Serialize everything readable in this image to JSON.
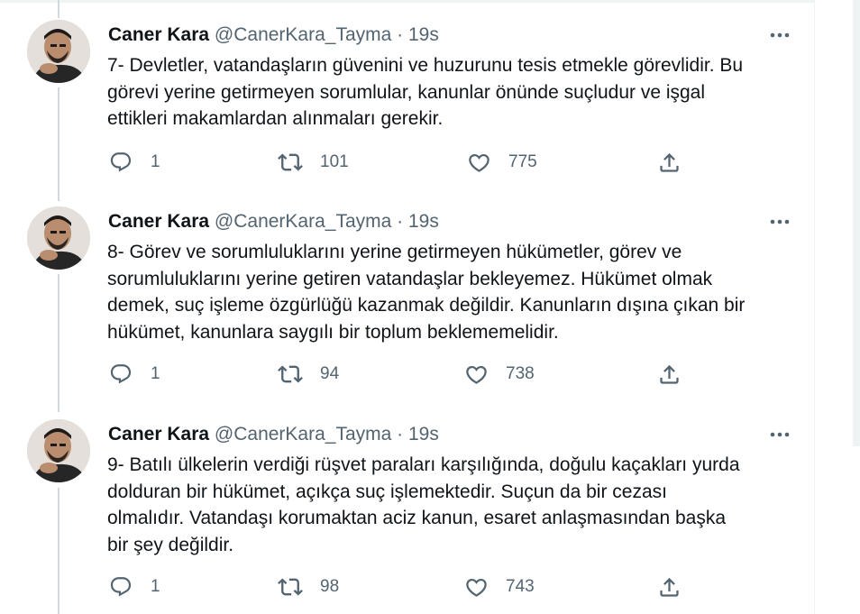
{
  "tweets": [
    {
      "name": "Caner Kara",
      "handle": "@CanerKara_Tayma",
      "time": "19s",
      "text": "7- Devletler, vatandaşların güvenini ve huzurunu tesis etmekle görevlidir. Bu\ngörevi yerine getirmeyen sorumlular, kanunlar önünde suçludur ve işgal\nettikleri makamlardan alınmaları gerekir.",
      "replies": "1",
      "retweets": "101",
      "likes": "775"
    },
    {
      "name": "Caner Kara",
      "handle": "@CanerKara_Tayma",
      "time": "19s",
      "text": "8- Görev ve sorumluluklarını yerine getirmeyen hükümetler, görev ve\nsorumluluklarını yerine getiren vatandaşlar bekleyemez. Hükümet olmak\ndemek, suç işleme özgürlüğü kazanmak değildir. Kanunların dışına çıkan bir\nhükümet, kanunlara saygılı bir toplum beklememelidir.",
      "replies": "1",
      "retweets": "94",
      "likes": "738"
    },
    {
      "name": "Caner Kara",
      "handle": "@CanerKara_Tayma",
      "time": "19s",
      "text": "9- Batılı ülkelerin verdiği rüşvet paraları karşılığında, doğulu kaçakları yurda\ndolduran bir hükümet, açıkça suç işlemektedir. Suçun da bir cezası\nolmalıdır. Vatandaşı korumaktan aciz kanun, esaret anlaşmasından başka\nbir şey değildir.",
      "replies": "1",
      "retweets": "98",
      "likes": "743"
    }
  ],
  "separator": "·",
  "icons": {
    "reply": "reply-icon",
    "retweet": "retweet-icon",
    "like": "heart-icon",
    "share": "share-icon",
    "more": "more-icon"
  },
  "colors": {
    "text": "#0f1419",
    "secondary": "#536471",
    "thread_line": "#cfd9de",
    "border": "#eff3f4"
  }
}
